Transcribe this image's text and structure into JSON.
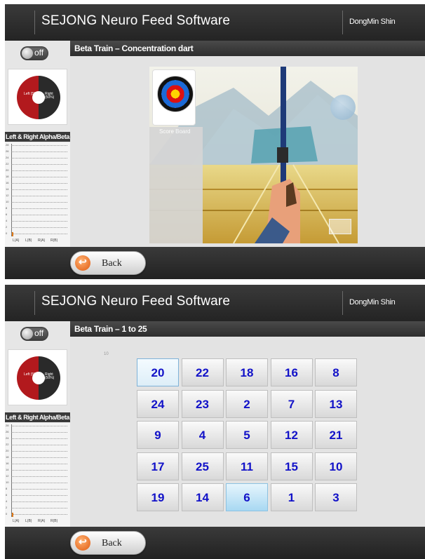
{
  "screens": [
    {
      "header": {
        "app_title": "SEJONG Neuro Feed Software",
        "user_name": "DongMin Shin"
      },
      "sidebar": {
        "toggle_label": "off",
        "donut": {
          "left_label": "Left (50%)",
          "right_label": "Right (50%)",
          "left_color": "#2a2a2a",
          "right_color": "#b2191d"
        },
        "graph_title": "Left & Right Alpha/Beta",
        "graph_y_ticks": [
          "28",
          "26",
          "24",
          "22",
          "20",
          "18",
          "16",
          "14",
          "12",
          "10",
          "8",
          "6",
          "4",
          "2",
          "0"
        ],
        "graph_x_ticks": [
          "L(A)",
          "L(B)",
          "R(A)",
          "R(B)"
        ]
      },
      "content_title": "Beta Train – Concentration dart",
      "game": {
        "scoreboard_title": "Score Board"
      },
      "footer": {
        "back_label": "Back"
      }
    },
    {
      "header": {
        "app_title": "SEJONG Neuro Feed Software",
        "user_name": "DongMin Shin"
      },
      "sidebar": {
        "toggle_label": "off",
        "donut": {
          "left_label": "Left (50%)",
          "right_label": "Right (50%)",
          "left_color": "#2a2a2a",
          "right_color": "#b2191d"
        },
        "graph_title": "Left & Right Alpha/Beta",
        "graph_y_ticks": [
          "28",
          "26",
          "24",
          "22",
          "20",
          "18",
          "16",
          "14",
          "12",
          "10",
          "8",
          "6",
          "4",
          "2",
          "0"
        ],
        "graph_x_ticks": [
          "L(A)",
          "L(B)",
          "R(A)",
          "R(B)"
        ]
      },
      "content_title": "Beta Train – 1 to 25",
      "grid_hint": "10",
      "number_grid": [
        [
          "20",
          "22",
          "18",
          "16",
          "8"
        ],
        [
          "24",
          "23",
          "2",
          "7",
          "13"
        ],
        [
          "9",
          "4",
          "5",
          "12",
          "21"
        ],
        [
          "17",
          "25",
          "11",
          "15",
          "10"
        ],
        [
          "19",
          "14",
          "6",
          "1",
          "3"
        ]
      ],
      "footer": {
        "back_label": "Back"
      }
    }
  ],
  "colors": {
    "number_text": "#1212c8",
    "header_bg": "#2c2c2c",
    "accent_orange": "#e05a10"
  }
}
